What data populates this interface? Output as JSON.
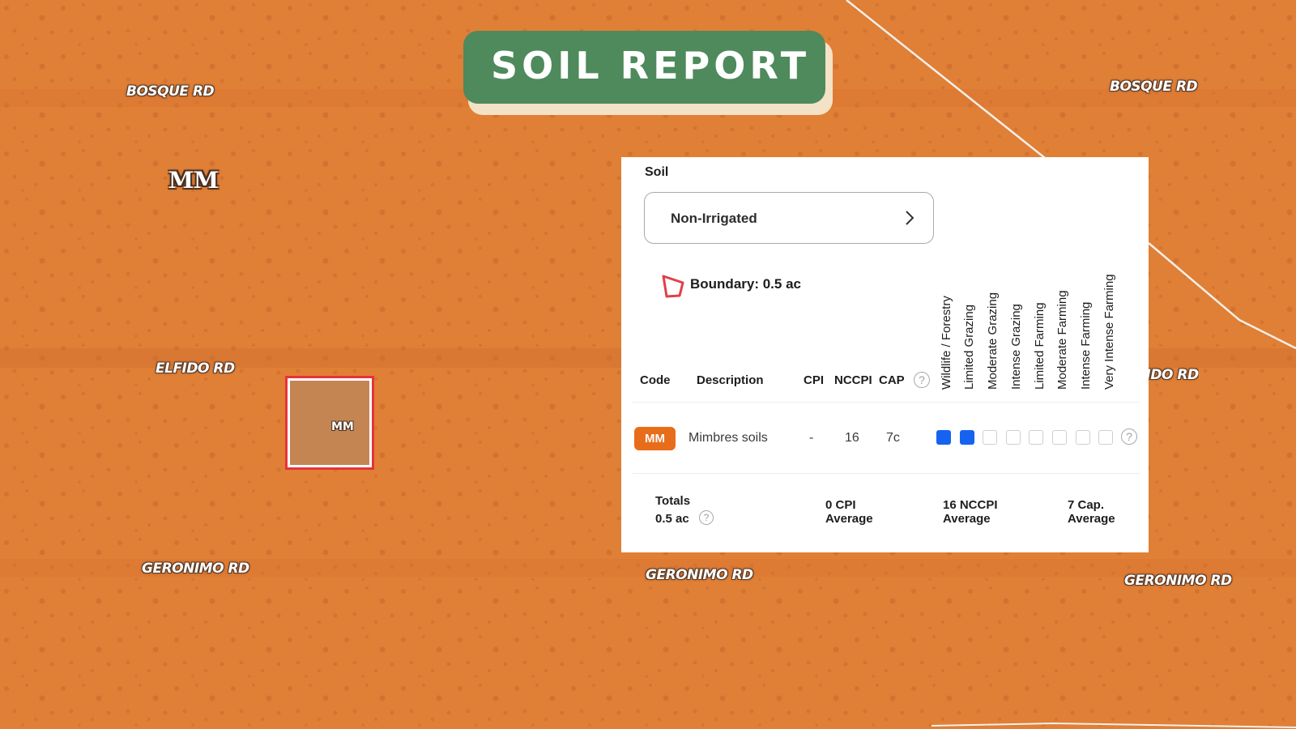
{
  "banner": {
    "title": "SOIL REPORT"
  },
  "map": {
    "roads": [
      "BOSQUE RD",
      "BOSQUE RD",
      "ELFIDO RD",
      "ELFIDO RD",
      "GERONIMO RD",
      "GERONIMO RD",
      "GERONIMO RD"
    ],
    "soil_label": "MM",
    "parcel_label": "MM"
  },
  "panel": {
    "section_title": "Soil",
    "dropdown_value": "Non-Irrigated",
    "boundary_text": "Boundary: 0.5 ac",
    "columns": {
      "code": "Code",
      "description": "Description",
      "cpi": "CPI",
      "nccpi": "NCCPI",
      "cap": "CAP",
      "help": "?"
    },
    "land_use_columns": [
      "Wildlife / Forestry",
      "Limited Grazing",
      "Moderate Grazing",
      "Intense Grazing",
      "Limited Farming",
      "Moderate Farming",
      "Intense Farming",
      "Very Intense Farming"
    ],
    "rows": [
      {
        "code": "MM",
        "description": "Mimbres soils",
        "cpi": "-",
        "nccpi": "16",
        "cap": "7c",
        "land_use": [
          true,
          true,
          false,
          false,
          false,
          false,
          false,
          false
        ],
        "help": "?"
      }
    ],
    "totals": {
      "label": "Totals",
      "area": "0.5 ac",
      "help": "?",
      "cpi": "0 CPI",
      "cpi_sub": "Average",
      "nccpi": "16 NCCPI",
      "nccpi_sub": "Average",
      "cap": "7 Cap.",
      "cap_sub": "Average"
    }
  },
  "colors": {
    "map_bg": "#e07f36",
    "banner_bg": "#4e8a5b",
    "badge": "#e86d1a",
    "selected_box": "#1663f2",
    "parcel_border": "#e8323a"
  }
}
